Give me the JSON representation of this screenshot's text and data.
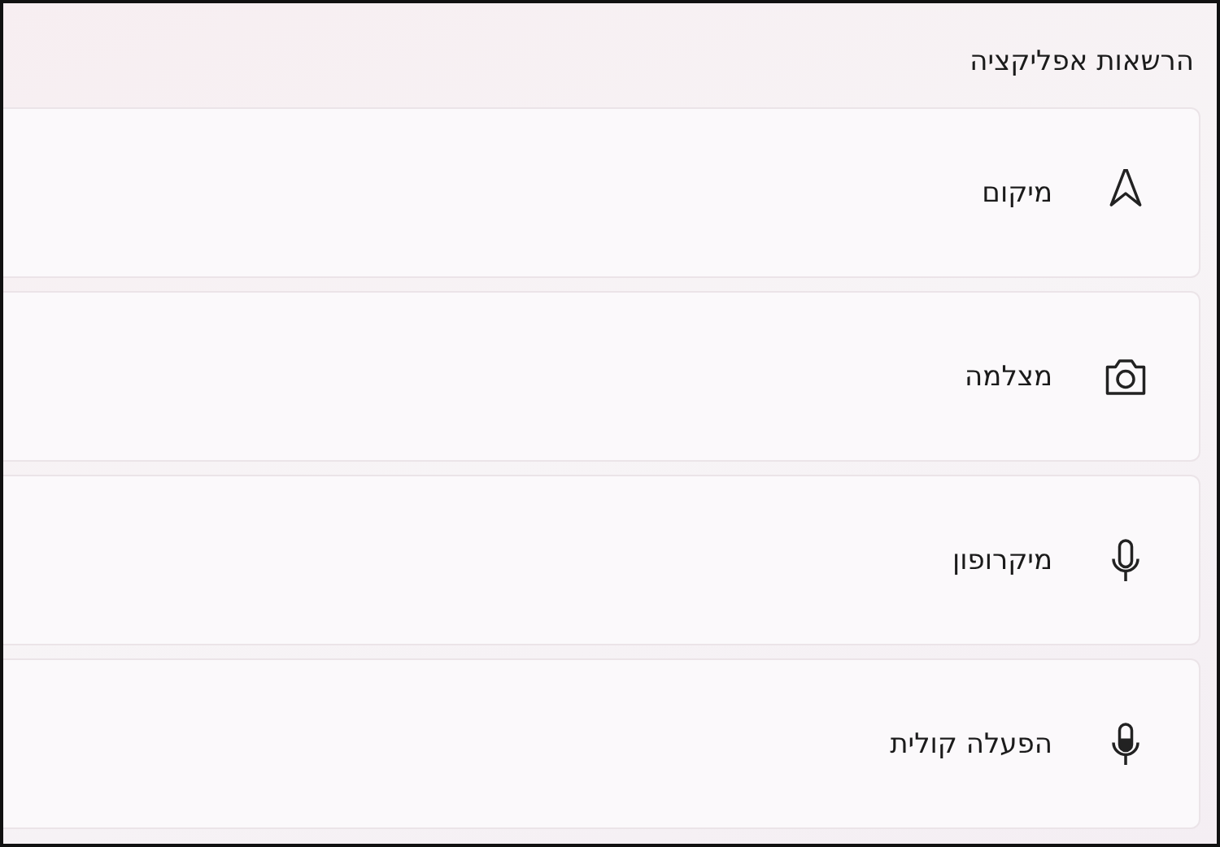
{
  "section": {
    "title": "הרשאות אפליקציה"
  },
  "permissions": [
    {
      "label": "מיקום"
    },
    {
      "label": "מצלמה"
    },
    {
      "label": "מיקרופון"
    },
    {
      "label": "הפעלה קולית"
    }
  ]
}
